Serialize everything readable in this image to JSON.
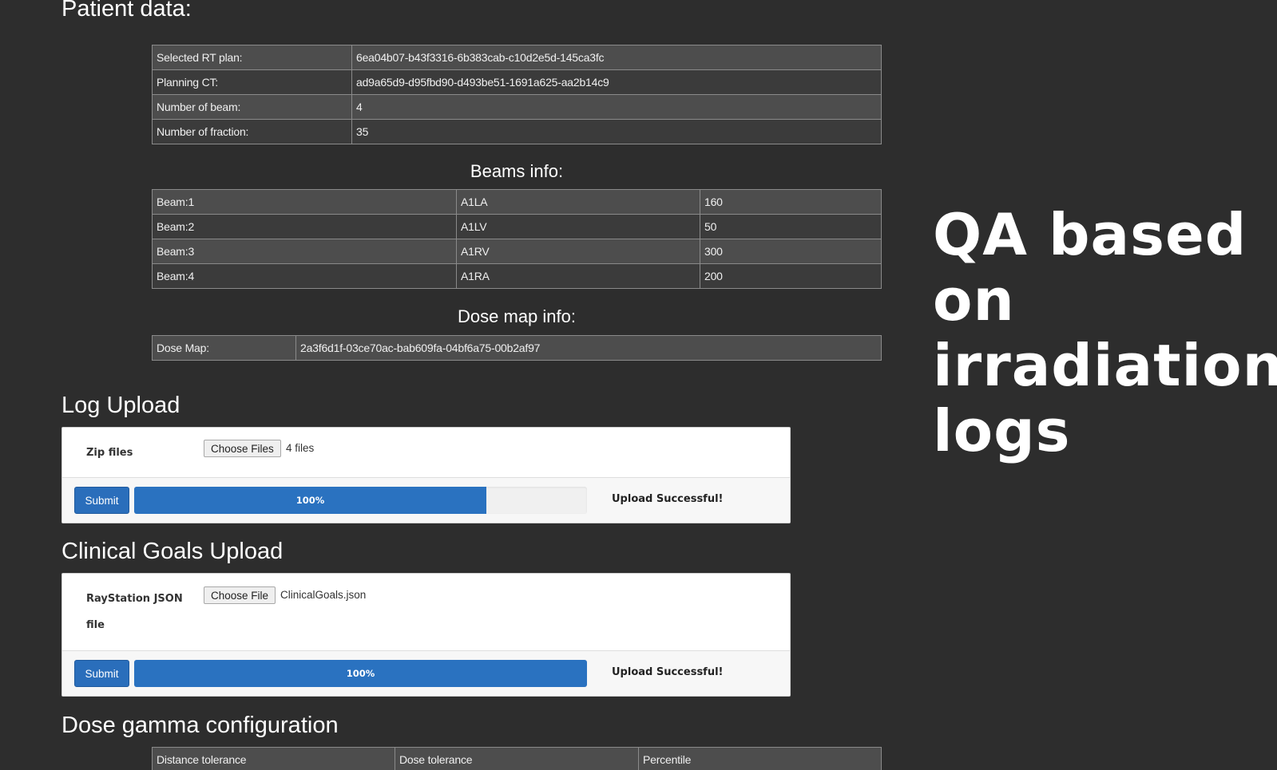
{
  "patient": {
    "title": "Patient data:",
    "rows": [
      {
        "label": "Selected RT plan:",
        "value": "6ea04b07-b43f3316-6b383cab-c10d2e5d-145ca3fc"
      },
      {
        "label": "Planning CT:",
        "value": "ad9a65d9-d95fbd90-d493be51-1691a625-aa2b14c9"
      },
      {
        "label": "Number of beam:",
        "value": "4"
      },
      {
        "label": "Number of fraction:",
        "value": "35"
      }
    ]
  },
  "beams": {
    "title": "Beams info:",
    "rows": [
      {
        "beam": "Beam:1",
        "name": "A1LA",
        "value": "160"
      },
      {
        "beam": "Beam:2",
        "name": "A1LV",
        "value": "50"
      },
      {
        "beam": "Beam:3",
        "name": "A1RV",
        "value": "300"
      },
      {
        "beam": "Beam:4",
        "name": "A1RA",
        "value": "200"
      }
    ]
  },
  "dosemap": {
    "title": "Dose map info:",
    "label": "Dose Map:",
    "value": "2a3f6d1f-03ce70ac-bab609fa-04bf6a75-00b2af97"
  },
  "log_upload": {
    "title": "Log Upload",
    "field_label": "Zip files",
    "choose_label": "Choose Files",
    "file_text": "4 files",
    "submit_label": "Submit",
    "progress_text": "100%",
    "progress_value": 100,
    "status": "Upload Successful!"
  },
  "goals_upload": {
    "title": "Clinical Goals Upload",
    "field_label_line1": "RayStation JSON",
    "field_label_line2": "file",
    "choose_label": "Choose File",
    "file_text": "ClinicalGoals.json",
    "submit_label": "Submit",
    "progress_text": "100%",
    "progress_value": 100,
    "status": "Upload Successful!"
  },
  "gamma": {
    "title": "Dose gamma configuration",
    "headers": [
      "Distance tolerance",
      "Dose tolerance",
      "Percentile"
    ]
  },
  "overlay": {
    "line1": "QA based",
    "line2": "on",
    "line3": "irradiation",
    "line4": "logs"
  }
}
